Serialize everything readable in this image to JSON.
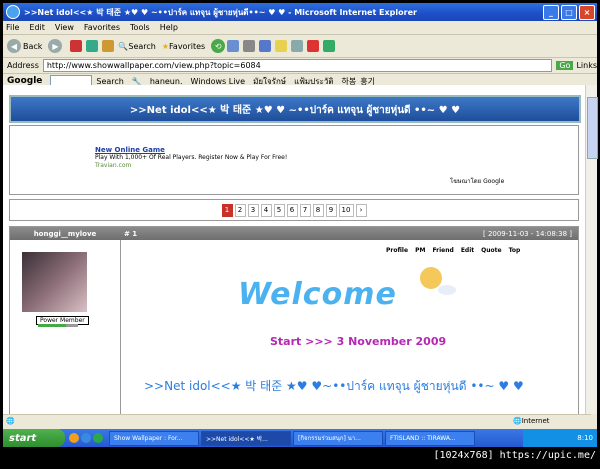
{
  "window": {
    "title": ">>Net idol<<★ 박 태준 ★♥ ♥ ~••ปาร์ค แทจุน ผู้ชายหุ่นดี••~ ♥ ♥ - Microsoft Internet Explorer"
  },
  "menu": [
    "File",
    "Edit",
    "View",
    "Favorites",
    "Tools",
    "Help"
  ],
  "toolbar": {
    "back": "Back",
    "search": "Search",
    "favorites": "Favorites"
  },
  "address": {
    "label": "Address",
    "url": "http://www.showwallpaper.com/view.php?topic=6084",
    "go": "Go",
    "links": "Links"
  },
  "google_bar": {
    "logo": "Google",
    "search": "Search",
    "haneun": "haneun.",
    "windows_live": "Windows Live",
    "item1": "มัยใจรักษ์",
    "item2": "แฟ้มประวัติ",
    "user": "하봉_훙기"
  },
  "banner": {
    "title": ">>Net idol<<★ 박 태준 ★♥ ♥ ~••ปาร์ค แทจุน ผู้ชายหุ่นดี ••~ ♥ ♥"
  },
  "ad": {
    "title": "New Online Game",
    "desc": "Play With 1,000+ Of Real Players. Register Now & Play For Free!",
    "domain": "Travian.com",
    "by": "โฆษณาโดย Google"
  },
  "pager": {
    "pages": [
      "1",
      "2",
      "3",
      "4",
      "5",
      "6",
      "7",
      "8",
      "9",
      "10"
    ],
    "current": "1",
    "next": "›"
  },
  "post": {
    "username": "honggi__mylove",
    "number": "# 1",
    "date": "[ 2009-11-03 - 14:08:38 ]",
    "rank": "Power Member",
    "buttons": [
      "Profile",
      "PM",
      "Friend",
      "Edit",
      "Quote",
      "Top"
    ],
    "welcome": "Welcome",
    "start": "Start >>> 3 November 2009",
    "title": ">>Net idol<<★ 박 태준 ★♥ ♥~••ปาร์ค แทจุน ผู้ชายหุ่นดี ••~ ♥ ♥"
  },
  "statusbar": {
    "zone": "Internet"
  },
  "taskbar": {
    "start": "start",
    "tasks": [
      "Show Wallpaper : For...",
      ">>Net idol<<★ 박...",
      "[กิจกรรมร่วมสนุก] นา...",
      "FTISLAND :: TIRAWA..."
    ],
    "time": "8:10"
  },
  "stamp": "[1024x768] https://upic.me/"
}
